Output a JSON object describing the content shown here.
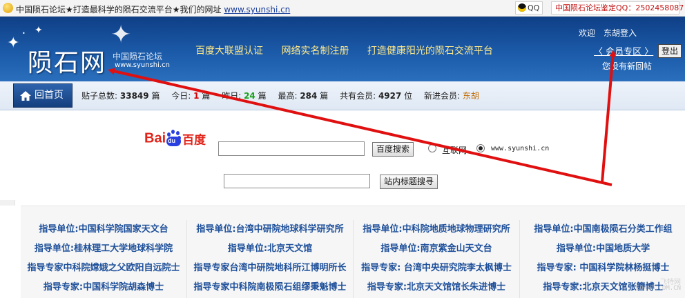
{
  "topbar": {
    "slogan": "中国陨石论坛★打造最科学的陨石交流平台★我们的网址",
    "url": "www.syunshi.cn",
    "qq_label": "QQ",
    "appraisal": "中国陨石论坛鉴定QQ：2502458087"
  },
  "header": {
    "logo_text": "陨石网",
    "logo_subtitle": "中国陨石论坛",
    "logo_url": "www.syunshi.cn",
    "links": [
      "百度大联盟认证",
      "网络实名制注册",
      "打造健康阳光的陨石交流平台"
    ],
    "welcome": "欢迎",
    "username": "东胡登入",
    "member_zone": "〈 会员专区 〉",
    "logout": "登出",
    "new_replies": "您没有新回帖"
  },
  "stats": {
    "home": "回首页",
    "posts_label": "贴子总数:",
    "posts": "33849",
    "unit_post": "篇",
    "today_label": "今日:",
    "today": "1",
    "yesterday_label": "昨日:",
    "yesterday": "24",
    "max_label": "最高:",
    "max": "284",
    "members_label": "共有会员:",
    "members": "4927",
    "unit_member": "位",
    "newest_label": "新进会员:",
    "newest": "东胡"
  },
  "search": {
    "baidu_logo_left": "Bai",
    "baidu_logo_mid": "du",
    "baidu_logo_right": "百度",
    "baidu_query": "",
    "baidu_button": "百度搜索",
    "option_web": "互联网",
    "option_site": "www.syunshi.cn",
    "site_query": "",
    "site_button": "站内标题搜寻"
  },
  "guide": {
    "columns": [
      [
        "指导单位:中国科学院国家天文台",
        "指导单位:桂林理工大学地球科学院",
        "指导专家中科院嫦娥之父欧阳自远院士",
        "指导专家:中国科学院胡森博士"
      ],
      [
        "指导单位:台湾中研院地球科学研究所",
        "指导单位:北京天文馆",
        "指导专家台湾中研院地科所江博明所长",
        "指导专家中科院南极陨石组缪秉魁博士"
      ],
      [
        "指导单位:中科院地质地球物理研究所",
        "指导单位:南京紫金山天文台",
        "指导专家: 台湾中央研究院李太枫博士",
        "指导专家:北京天文馆馆长朱进博士"
      ],
      [
        "指导单位:中国南极陨石分类工作组",
        "指导单位:中国地质大学",
        "指导专家: 中国科学院林杨挺博士",
        "指导专家:北京天文馆张簪博士"
      ]
    ]
  },
  "watermark": {
    "brand": "飞特网",
    "domain": "COANT.COM.CN"
  },
  "colors": {
    "header_blue": "#1b5aa8",
    "link_yellow": "#ffe98a",
    "guide_blue": "#1d4f9a",
    "arrow_red": "#e01010"
  }
}
